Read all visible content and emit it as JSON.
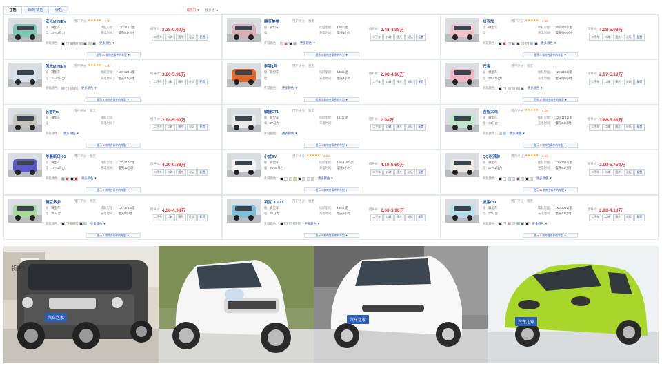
{
  "tabs": [
    "在售",
    "即将销售",
    "停售"
  ],
  "sort": {
    "hot": "最热门 ▼",
    "price": "按价格 ▲"
  },
  "labels": {
    "score": "用户评分：",
    "level": "级",
    "level_val": "微型车",
    "power": "电",
    "range": "续航里程：",
    "charge": "充电时间：",
    "colors": "外观颜色：",
    "more_colors": "更多颜色 ▼",
    "guide": "指导价：",
    "btn_used": "二手车",
    "btn_quote": "口碑",
    "btn_photo": "图片",
    "btn_config": "论坛",
    "btn_compare": "配置"
  },
  "cars": [
    {
      "name": "宏光MINIEV",
      "stars": "★★★★★",
      "score": "4.41",
      "power": "20-41马力",
      "range": "120-215公里",
      "charge": "慢充5.5小时",
      "price": "3.28-9.99万",
      "more": "20",
      "colors": [
        "#1a1a1a",
        "#e8e8e8",
        "#8ec6d8",
        "#b9d7c8",
        "#f2c7d0",
        "#3a6b5c",
        "#d8d3b8",
        "#2d5b86"
      ],
      "car": "#7fc9b4"
    },
    {
      "name": "糖豆美美",
      "stars": "",
      "score": "暂无",
      "power": "",
      "range": "180公里",
      "charge": "慢充5小时",
      "price": "2.48-4.98万",
      "more": "5",
      "colors": [
        "#e9e0d8",
        "#d45a6a",
        "#1c2a5c",
        "#c8a3a8"
      ],
      "car": "#d9b0b7"
    },
    {
      "name": "知豆加",
      "stars": "★★★★★",
      "score": "4.56",
      "power": "",
      "range": "205-225公里",
      "charge": "慢充约6小时",
      "price": "4.98-5.98万",
      "more": "5",
      "colors": [
        "#1c1c1c",
        "#e03c3c",
        "#f6d7e0",
        "#4a8fd4",
        "#3a3a3a",
        "#c6e7d9",
        "#e7e2c8",
        "#8ec5e8",
        "#3b3b3b"
      ],
      "car": "#f2c3cf"
    },
    {
      "name": "风光MINIEV",
      "stars": "★★★★★",
      "score": "4.37",
      "power": "34-41马力",
      "range": "120-220公里",
      "charge": "慢充3.5小时",
      "price": "3.26-5.91万",
      "more": "8",
      "colors": [
        "#9ed2f0",
        "#f5f5f5",
        "#f5c6d0",
        "#d8cfe8"
      ],
      "car": "#d6e3ec"
    },
    {
      "name": "李导1号",
      "stars": "",
      "score": "暂无",
      "power": "",
      "range": "130公里",
      "charge": "慢充4小时",
      "price": "2.98-4.98万",
      "more": "3",
      "colors": [],
      "car": "#e0692a"
    },
    {
      "name": "元宝",
      "stars": "",
      "score": "暂无",
      "power": "27-41马力",
      "range": "120-225公里",
      "charge": "慢充约5小时",
      "price": "2.97-5.19万",
      "more": "10",
      "colors": [
        "#1a1a1a",
        "#ffffff",
        "#e4d4c8",
        "#bcd6e8",
        "#c8c8c8",
        "#3f7a6a"
      ],
      "car": "#f0b6c6"
    },
    {
      "name": "艺智Pro",
      "stars": "",
      "score": "暂无",
      "power": "",
      "range": "",
      "charge": "",
      "price": "2.98-5.99万",
      "more": "1",
      "colors": [],
      "car": "#c7c4be"
    },
    {
      "name": "敏捷ET1",
      "stars": "",
      "score": "暂无",
      "power": "27马力",
      "range": "152公里",
      "charge": "",
      "price": "2.98万",
      "more": "1",
      "colors": [],
      "car": "#e9e9e9"
    },
    {
      "name": "吉智大鸡",
      "stars": "★★★★★",
      "score": "4.48",
      "power": "34马力",
      "range": "120-173公里",
      "charge": "慢充5.5小时",
      "price": "3.88-5.88万",
      "more": "6",
      "colors": [
        "#c6e4d4",
        "#89c9e9"
      ],
      "car": "#bfe6c9"
    },
    {
      "name": "华晨新日i03",
      "stars": "",
      "score": "暂无",
      "power": "27-41马力",
      "range": "170-310公里",
      "charge": "慢充12小时",
      "price": "4.29-9.88万",
      "more": "2",
      "colors": [
        "#5fa7b8",
        "#e34f6b",
        "#1a1a1a",
        "#b52a2a"
      ],
      "car": "#5e58c9"
    },
    {
      "name": "小虎EV",
      "stars": "★★★★★",
      "score": "4.63",
      "power": "40-48马力",
      "range": "160-215公里",
      "charge": "慢充6小时",
      "price": "4.19-5.59万",
      "more": "5",
      "colors": [
        "#1a1a1a",
        "#ffffff",
        "#e8e8e8",
        "#f4d24a",
        "#3a3a3a",
        "#d6d6d6",
        "#e8e8e8",
        "#b4dcd0"
      ],
      "car": "#f2f2f2"
    },
    {
      "name": "QQ冰淇淋",
      "stars": "★★★★★",
      "score": "4.52",
      "power": "27-41马力",
      "range": "120-205公里",
      "charge": "慢充5.5小时",
      "price": "2.99-5.752万",
      "more": "18",
      "colors": [
        "#1a1a1a",
        "#ffffff",
        "#b4e0f0",
        "#e6e6e6",
        "#5a5a9a",
        "#f5c8d4",
        "#1a1a1a",
        "#c4e4e4"
      ],
      "car": "#ece8e0"
    },
    {
      "name": "糖豆多多",
      "stars": "",
      "score": "暂无",
      "power": "30马力",
      "range": "120-175公里",
      "charge": "慢充5小时",
      "price": "4.68-4.98万",
      "more": "2",
      "colors": [
        "#2c2c2c",
        "#f2f2f2",
        "#e8c56a",
        "#cfe6d0",
        "#3a3a3a",
        "#9cc4e8"
      ],
      "car": "#a8d89a"
    },
    {
      "name": "凌宝COCO",
      "stars": "",
      "score": "暂无",
      "power": "36马力",
      "range": "190公里",
      "charge": "慢充5小时",
      "price": "2.68-3.98万",
      "more": "6",
      "colors": [
        "#1a1a1a",
        "#f2f2f2",
        "#e5e5e5",
        "#b6e0ea",
        "#c8ece0"
      ],
      "car": "#7fc0d8"
    },
    {
      "name": "凌宝uni",
      "stars": "",
      "score": "暂无",
      "power": "27马力",
      "range": "160-201公里",
      "charge": "慢充4.5小时",
      "price": "2.98-4.18万",
      "more": "6",
      "colors": [
        "#3a3a3a",
        "#f2f2f2",
        "#d68fa5",
        "#d6d6d6",
        "#7ac0d8",
        "#3b6aa8",
        "#1a1a1a"
      ],
      "car": "#b5dfe8"
    }
  ],
  "photos": [
    {
      "watermark": "汽车之家",
      "car": "#4a4a4a",
      "bg": "#b9b0a3"
    },
    {
      "watermark": "",
      "car": "#f4f4f4",
      "bg": "#9da97a"
    },
    {
      "watermark": "汽车之家",
      "car": "#f7f7f7",
      "bg": "#8e8e8e"
    },
    {
      "watermark": "汽车之家",
      "car": "#a8d62b",
      "bg": "#eef1f3"
    }
  ],
  "bg_sign": "领航5"
}
